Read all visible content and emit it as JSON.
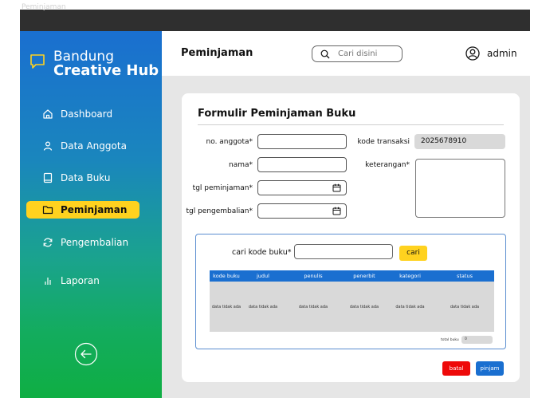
{
  "window": {
    "title": "Peminjaman"
  },
  "brand": {
    "line1": "Bandung",
    "line2": "Creative Hub"
  },
  "sidebar": {
    "items": [
      {
        "label": "Dashboard",
        "icon": "home-icon"
      },
      {
        "label": "Data Anggota",
        "icon": "user-icon"
      },
      {
        "label": "Data Buku",
        "icon": "book-icon"
      },
      {
        "label": "Peminjaman",
        "icon": "folder-icon",
        "active": true
      },
      {
        "label": "Pengembalian",
        "icon": "refresh-icon"
      },
      {
        "label": "Laporan",
        "icon": "bar-chart-icon"
      }
    ]
  },
  "header": {
    "title": "Peminjaman",
    "search_placeholder": "Cari disini",
    "user": "admin"
  },
  "form": {
    "title": "Formulir Peminjaman Buku",
    "no_anggota_label": "no. anggota*",
    "nama_label": "nama*",
    "tgl_pinjam_label": "tgl peminjaman*",
    "tgl_kembali_label": "tgl pengembalian*",
    "kode_transaksi_label": "kode transaksi",
    "kode_transaksi_value": "2025678910",
    "keterangan_label": "keterangan*"
  },
  "book_search": {
    "label": "cari kode buku*",
    "button": "cari",
    "columns": [
      "kode buku",
      "judul",
      "penulis",
      "penerbit",
      "kategori",
      "status"
    ],
    "rows": [
      [
        "data tidak ada",
        "data tidak ada",
        "data tidak ada",
        "data tidak ada",
        "data tidak ada",
        "data tidak ada"
      ]
    ],
    "total_label": "total buku",
    "total_value": "0"
  },
  "actions": {
    "cancel": "batal",
    "submit": "pinjam"
  },
  "colors": {
    "primary": "#1a6fd0",
    "accent": "#ffd21f",
    "danger": "#ee0a0a",
    "sidebar_gradient_start": "#1a6fd0",
    "sidebar_gradient_end": "#0fae43"
  }
}
